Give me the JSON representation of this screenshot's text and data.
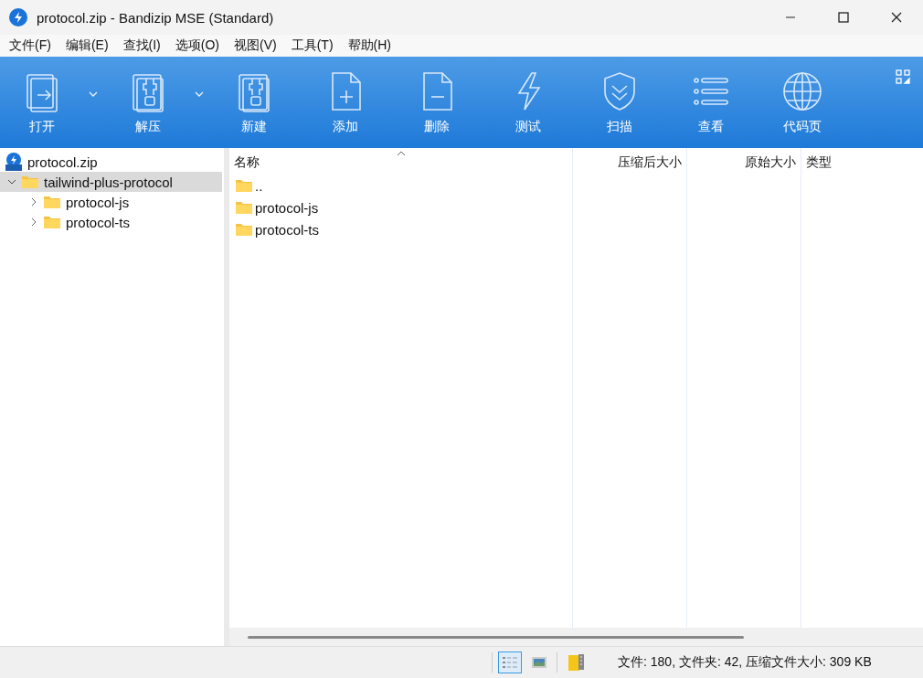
{
  "window": {
    "title": "protocol.zip - Bandizip MSE (Standard)"
  },
  "menu": [
    "文件(F)",
    "编辑(E)",
    "查找(I)",
    "选项(O)",
    "视图(V)",
    "工具(T)",
    "帮助(H)"
  ],
  "toolbar": [
    {
      "label": "打开",
      "dropdown": true
    },
    {
      "label": "解压",
      "dropdown": true
    },
    {
      "label": "新建",
      "dropdown": false
    },
    {
      "label": "添加",
      "dropdown": false
    },
    {
      "label": "删除",
      "dropdown": false
    },
    {
      "label": "测试",
      "dropdown": false
    },
    {
      "label": "扫描",
      "dropdown": false
    },
    {
      "label": "查看",
      "dropdown": false
    },
    {
      "label": "代码页",
      "dropdown": false
    }
  ],
  "tree": {
    "label": "protocol.zip",
    "children": [
      {
        "label": "tailwind-plus-protocol",
        "expanded": true,
        "selected": true,
        "children": [
          {
            "label": "protocol-js",
            "expanded": false,
            "selected": false
          },
          {
            "label": "protocol-ts",
            "expanded": false,
            "selected": false
          }
        ]
      }
    ]
  },
  "file_list": {
    "columns": [
      {
        "label": "名称",
        "sorted": true
      },
      {
        "label": "压缩后大小",
        "sorted": false
      },
      {
        "label": "原始大小",
        "sorted": false
      },
      {
        "label": "类型",
        "sorted": false
      }
    ],
    "rows": [
      {
        "name": ".."
      },
      {
        "name": "protocol-js"
      },
      {
        "name": "protocol-ts"
      }
    ]
  },
  "status_bar": {
    "views": [
      {
        "kind": "details",
        "selected": true
      },
      {
        "kind": "thumbnails",
        "selected": false
      }
    ],
    "text": "文件: 180, 文件夹: 42, 压缩文件大小: 309 KB"
  }
}
